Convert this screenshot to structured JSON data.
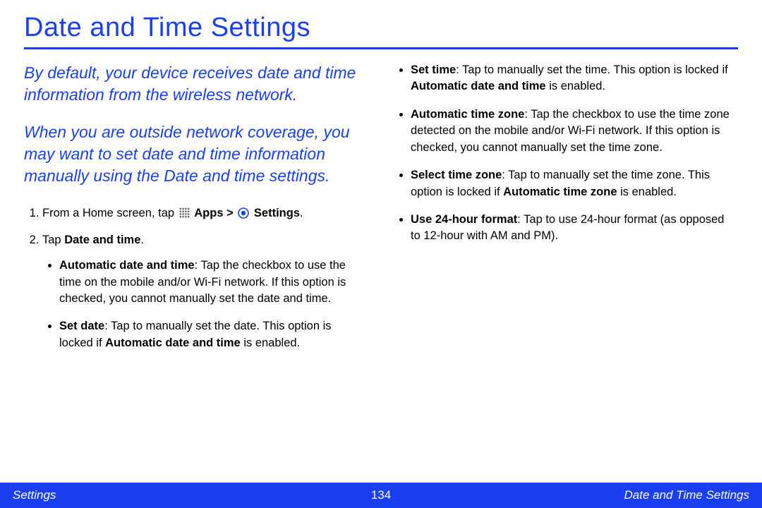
{
  "title": "Date and Time Settings",
  "intro1": "By default, your device receives date and time information from the wireless network.",
  "intro2": "When you are outside network coverage, you may want to set date and time information manually using the Date and time settings.",
  "step1": {
    "pre": "From a Home screen, tap ",
    "appsLabel": "Apps",
    "gt": " > ",
    "settingsLabel": "Settings",
    "post": "."
  },
  "step2": {
    "pre": "Tap ",
    "bold": "Date and time",
    "post": "."
  },
  "left_bullets": [
    {
      "boldLead": "Automatic date and time",
      "rest": ": Tap the checkbox to use the time on the mobile and/or Wi-Fi network. If this option is checked, you cannot manually set the date and time."
    },
    {
      "boldLead": "Set date",
      "rest1": ": Tap to manually set the date. This option is locked if ",
      "bold2": "Automatic date and time",
      "rest2": " is enabled."
    }
  ],
  "right_bullets": [
    {
      "boldLead": "Set time",
      "rest1": ": Tap to manually set the time. This option is locked if ",
      "bold2": "Automatic date and time",
      "rest2": " is enabled."
    },
    {
      "boldLead": "Automatic time zone",
      "rest": ": Tap the checkbox to use the time zone detected on the mobile and/or Wi-Fi network. If this option is checked, you cannot manually set the time zone."
    },
    {
      "boldLead": "Select time zone",
      "rest1": ": Tap to manually set the time zone. This option is locked if ",
      "bold2": "Automatic time zone",
      "rest2": " is enabled."
    },
    {
      "boldLead": "Use 24-hour format",
      "rest": ": Tap to use 24-hour format (as opposed to 12-hour with AM and PM)."
    }
  ],
  "footer": {
    "left": "Settings",
    "page": "134",
    "right": "Date and Time Settings"
  }
}
